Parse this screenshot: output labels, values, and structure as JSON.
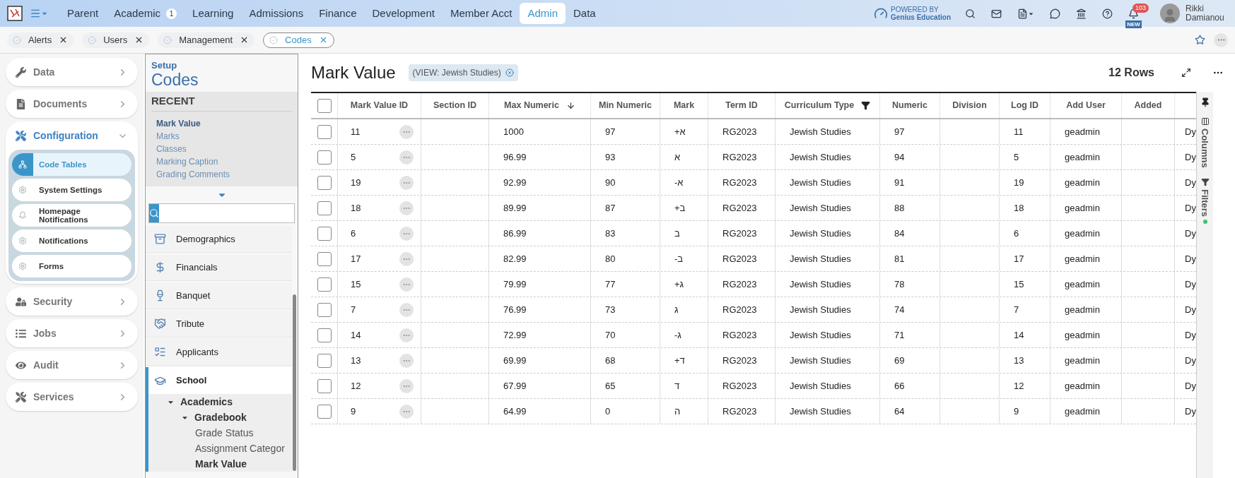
{
  "top_nav": {
    "items": [
      {
        "label": "Parent",
        "selected": false
      },
      {
        "label": "Academic",
        "selected": false,
        "badge": "1"
      },
      {
        "label": "Learning",
        "selected": false
      },
      {
        "label": "Admissions",
        "selected": false
      },
      {
        "label": "Finance",
        "selected": false
      },
      {
        "label": "Development",
        "selected": false
      },
      {
        "label": "Member Acct",
        "selected": false
      },
      {
        "label": "Admin",
        "selected": true
      },
      {
        "label": "Data",
        "selected": false
      }
    ],
    "powered_by": "POWERED BY",
    "brand": "Genius Education",
    "notifications_badge": "103",
    "new_label": "NEW",
    "user_name": "Rikki Damianou"
  },
  "open_tabs": [
    {
      "label": "Alerts",
      "selected": false
    },
    {
      "label": "Users",
      "selected": false
    },
    {
      "label": "Management",
      "selected": false
    },
    {
      "label": "Codes",
      "selected": true
    }
  ],
  "sidebar": {
    "items": [
      {
        "label": "Data",
        "expanded": false
      },
      {
        "label": "Documents",
        "expanded": false
      },
      {
        "label": "Configuration",
        "expanded": true,
        "children": [
          {
            "label": "Code Tables",
            "selected": true
          },
          {
            "label": "System Settings",
            "selected": false
          },
          {
            "label": "Homepage Notifications",
            "selected": false
          },
          {
            "label": "Notifications",
            "selected": false
          },
          {
            "label": "Forms",
            "selected": false
          }
        ]
      },
      {
        "label": "Security",
        "expanded": false
      },
      {
        "label": "Jobs",
        "expanded": false
      },
      {
        "label": "Audit",
        "expanded": false
      },
      {
        "label": "Services",
        "expanded": false
      }
    ]
  },
  "setup_panel": {
    "kicker": "Setup",
    "title": "Codes",
    "recent_heading": "RECENT",
    "recent": [
      {
        "label": "Mark Value",
        "selected": true
      },
      {
        "label": "Marks",
        "selected": false
      },
      {
        "label": "Classes",
        "selected": false
      },
      {
        "label": "Marking Caption",
        "selected": false
      },
      {
        "label": "Grading Comments",
        "selected": false
      }
    ],
    "categories": [
      {
        "label": "Demographics",
        "selected": false
      },
      {
        "label": "Financials",
        "selected": false
      },
      {
        "label": "Banquet",
        "selected": false
      },
      {
        "label": "Tribute",
        "selected": false
      },
      {
        "label": "Applicants",
        "selected": false
      },
      {
        "label": "School",
        "selected": true,
        "children": [
          {
            "label": "Academics",
            "expanded": true,
            "children": [
              {
                "label": "Gradebook",
                "expanded": true,
                "children": [
                  {
                    "label": "Grade Status",
                    "selected": false
                  },
                  {
                    "label": "Assignment Categor",
                    "selected": false
                  },
                  {
                    "label": "Mark Value",
                    "selected": true
                  }
                ]
              }
            ]
          }
        ]
      }
    ]
  },
  "main": {
    "title": "Mark Value",
    "view_chip": "(VIEW: Jewish Studies)",
    "row_count": "12 Rows",
    "table": {
      "all_checked": false,
      "columns": [
        {
          "label": "Mark Value ID",
          "filtered": false
        },
        {
          "label": "Section ID",
          "filtered": false
        },
        {
          "label": "Max Numeric",
          "filtered": false,
          "sorted": true
        },
        {
          "label": "Min Numeric",
          "filtered": false
        },
        {
          "label": "Mark",
          "filtered": false
        },
        {
          "label": "Term ID",
          "filtered": false
        },
        {
          "label": "Curriculum Type",
          "filtered": true
        },
        {
          "label": "Numeric",
          "filtered": false
        },
        {
          "label": "Division",
          "filtered": false
        },
        {
          "label": "Log ID",
          "filtered": false
        },
        {
          "label": "Add User",
          "filtered": false
        },
        {
          "label": "Added",
          "filtered": false
        }
      ],
      "rows": [
        {
          "checked": false,
          "cells": [
            "11",
            "",
            "1000",
            "97",
            "+א",
            "RG2023",
            "Jewish Studies",
            "97",
            "",
            "11",
            "geadmin",
            "",
            "Dy"
          ]
        },
        {
          "checked": false,
          "cells": [
            "5",
            "",
            "96.99",
            "93",
            "א",
            "RG2023",
            "Jewish Studies",
            "94",
            "",
            "5",
            "geadmin",
            "",
            "Dy"
          ]
        },
        {
          "checked": false,
          "cells": [
            "19",
            "",
            "92.99",
            "90",
            "-א",
            "RG2023",
            "Jewish Studies",
            "91",
            "",
            "19",
            "geadmin",
            "",
            "Dy"
          ]
        },
        {
          "checked": false,
          "cells": [
            "18",
            "",
            "89.99",
            "87",
            "+ב",
            "RG2023",
            "Jewish Studies",
            "88",
            "",
            "18",
            "geadmin",
            "",
            "Dy"
          ]
        },
        {
          "checked": false,
          "cells": [
            "6",
            "",
            "86.99",
            "83",
            "ב",
            "RG2023",
            "Jewish Studies",
            "84",
            "",
            "6",
            "geadmin",
            "",
            "Dy"
          ]
        },
        {
          "checked": false,
          "cells": [
            "17",
            "",
            "82.99",
            "80",
            "-ב",
            "RG2023",
            "Jewish Studies",
            "81",
            "",
            "17",
            "geadmin",
            "",
            "Dy"
          ]
        },
        {
          "checked": false,
          "cells": [
            "15",
            "",
            "79.99",
            "77",
            "+ג",
            "RG2023",
            "Jewish Studies",
            "78",
            "",
            "15",
            "geadmin",
            "",
            "Dy"
          ]
        },
        {
          "checked": false,
          "cells": [
            "7",
            "",
            "76.99",
            "73",
            "ג",
            "RG2023",
            "Jewish Studies",
            "74",
            "",
            "7",
            "geadmin",
            "",
            "Dy"
          ]
        },
        {
          "checked": false,
          "cells": [
            "14",
            "",
            "72.99",
            "70",
            "-ג",
            "RG2023",
            "Jewish Studies",
            "71",
            "",
            "14",
            "geadmin",
            "",
            "Dy"
          ]
        },
        {
          "checked": false,
          "cells": [
            "13",
            "",
            "69.99",
            "68",
            "+ד",
            "RG2023",
            "Jewish Studies",
            "69",
            "",
            "13",
            "geadmin",
            "",
            "Dy"
          ]
        },
        {
          "checked": false,
          "cells": [
            "12",
            "",
            "67.99",
            "65",
            "ד",
            "RG2023",
            "Jewish Studies",
            "66",
            "",
            "12",
            "geadmin",
            "",
            "Dy"
          ]
        },
        {
          "checked": false,
          "cells": [
            "9",
            "",
            "64.99",
            "0",
            "ה",
            "RG2023",
            "Jewish Studies",
            "64",
            "",
            "9",
            "geadmin",
            "",
            "Dy"
          ]
        }
      ]
    },
    "side_panel": [
      {
        "label": "Columns",
        "active": false
      },
      {
        "label": "Filters",
        "active": true
      }
    ]
  }
}
